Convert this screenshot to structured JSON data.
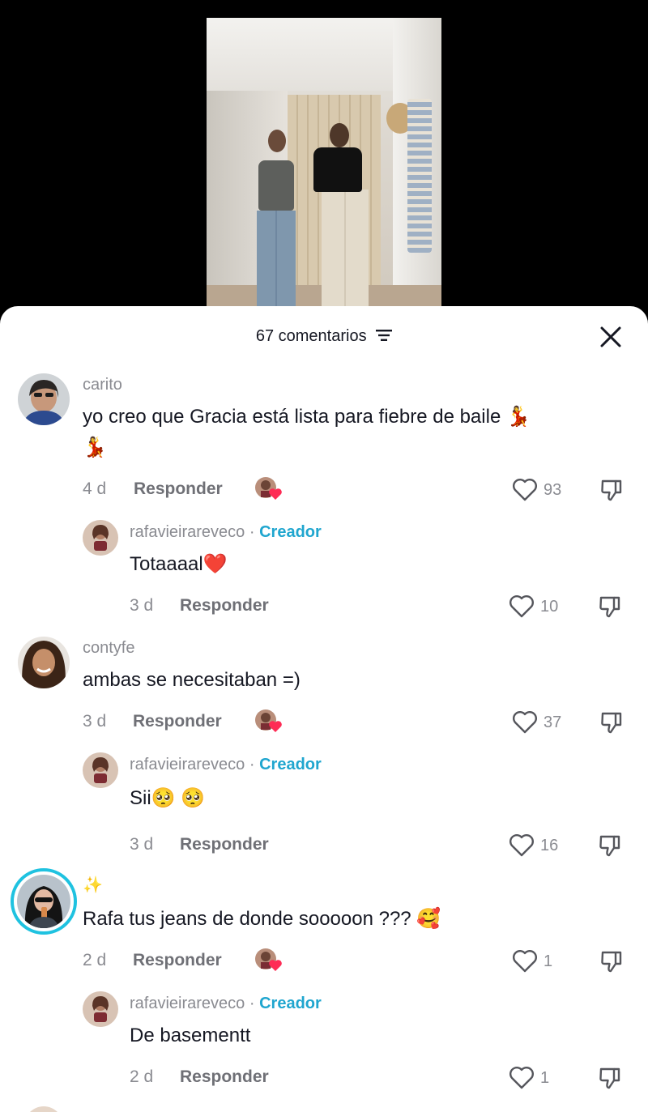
{
  "sheet": {
    "comment_count": "67 comentarios"
  },
  "comments": [
    {
      "user": "carito",
      "text_line1": "yo creo que Gracia está lista para fiebre de baile 💃",
      "text_line2": "💃",
      "time": "4 d",
      "reply_label": "Responder",
      "likes": "93",
      "reply": {
        "user": "rafavieirareveco",
        "separator": "·",
        "badge": "Creador",
        "text": "Totaaaal❤️",
        "time": "3 d",
        "reply_label": "Responder",
        "likes": "10"
      }
    },
    {
      "user": "contyfe",
      "text_line1": "ambas se necesitaban =)",
      "time": "3 d",
      "reply_label": "Responder",
      "likes": "37",
      "reply": {
        "user": "rafavieirareveco",
        "separator": "·",
        "badge": "Creador",
        "text": "Sii🥺 🥺",
        "time": "3 d",
        "reply_label": "Responder",
        "likes": "16"
      }
    },
    {
      "user": "✨",
      "text_line1": "Rafa tus jeans de donde sooooon ??? 🥰",
      "time": "2 d",
      "reply_label": "Responder",
      "likes": "1",
      "reply": {
        "user": "rafavieirareveco",
        "separator": "·",
        "badge": "Creador",
        "text": "De basementt",
        "time": "2 d",
        "reply_label": "Responder",
        "likes": "1"
      }
    }
  ],
  "icons": {
    "filter": "filter-icon",
    "close": "close-icon",
    "heart": "heart-icon",
    "dislike": "dislike-icon"
  },
  "colors": {
    "creator_badge": "#20a6cf",
    "heart_badge": "#fe2c55",
    "story_ring": "#1fc2e0"
  }
}
